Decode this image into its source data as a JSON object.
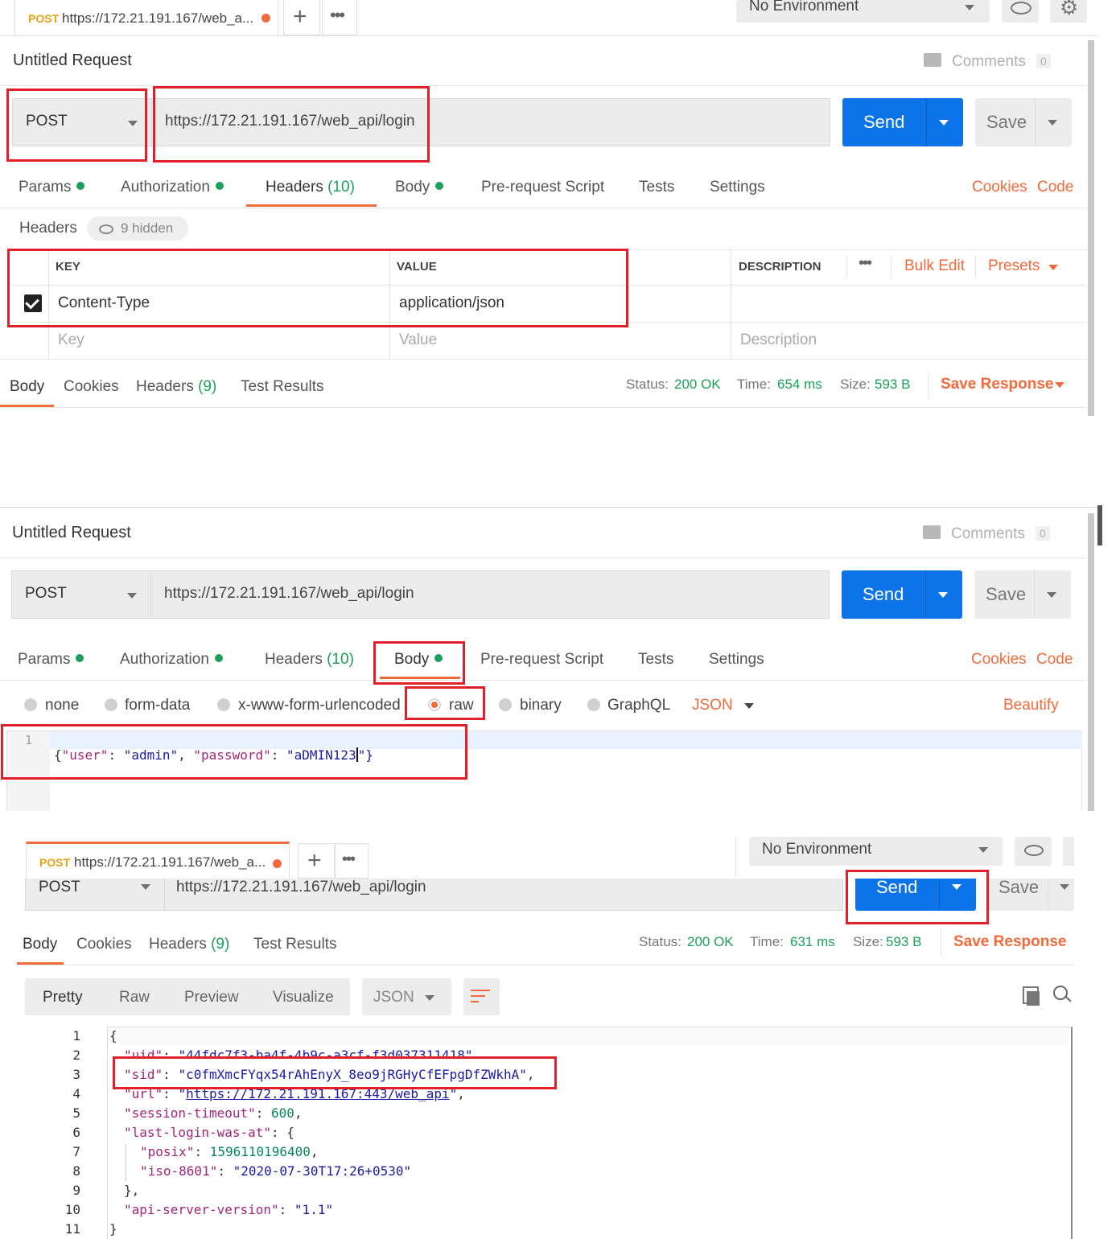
{
  "colors": {
    "accent": "#f26b3a",
    "send": "#0c74e8",
    "ok": "#1aa05a",
    "annotation": "#e2202a"
  },
  "panel1": {
    "tab": {
      "method": "POST",
      "title": "https://172.21.191.167/web_a..."
    },
    "environment": "No Environment",
    "request_name": "Untitled Request",
    "comments_label": "Comments",
    "comments_count": "0",
    "method": "POST",
    "url": "https://172.21.191.167/web_api/login",
    "send_label": "Send",
    "save_label": "Save",
    "tabs": {
      "params": "Params",
      "authorization": "Authorization",
      "headers": "Headers",
      "headers_count": "(10)",
      "body": "Body",
      "prerequest": "Pre-request Script",
      "tests": "Tests",
      "settings": "Settings",
      "cookies": "Cookies",
      "code": "Code"
    },
    "headers_title": "Headers",
    "hidden_label": "9 hidden",
    "columns": {
      "key": "KEY",
      "value": "VALUE",
      "description": "DESCRIPTION",
      "bulk_edit": "Bulk Edit",
      "presets": "Presets"
    },
    "row": {
      "key": "Content-Type",
      "value": "application/json"
    },
    "placeholders": {
      "key": "Key",
      "value": "Value",
      "description": "Description"
    },
    "response_tabs": {
      "body": "Body",
      "cookies": "Cookies",
      "headers": "Headers",
      "headers_count": "(9)",
      "test_results": "Test Results"
    },
    "status": {
      "status_label": "Status:",
      "status_value": "200 OK",
      "time_label": "Time:",
      "time_value": "654 ms",
      "size_label": "Size:",
      "size_value": "593 B",
      "save_response": "Save Response"
    }
  },
  "panel2": {
    "request_name": "Untitled Request",
    "comments_label": "Comments",
    "comments_count": "0",
    "method": "POST",
    "url": "https://172.21.191.167/web_api/login",
    "send_label": "Send",
    "save_label": "Save",
    "tabs": {
      "params": "Params",
      "authorization": "Authorization",
      "headers": "Headers",
      "headers_count": "(10)",
      "body": "Body",
      "prerequest": "Pre-request Script",
      "tests": "Tests",
      "settings": "Settings",
      "cookies": "Cookies",
      "code": "Code"
    },
    "body_types": {
      "none": "none",
      "form_data": "form-data",
      "urlencoded": "x-www-form-urlencoded",
      "raw": "raw",
      "binary": "binary",
      "graphql": "GraphQL",
      "format": "JSON",
      "beautify": "Beautify"
    },
    "editor": {
      "line_number": "1",
      "open": "{",
      "k1": "\"user\"",
      "colon1": ": ",
      "v1": "\"admin\"",
      "comma1": ", ",
      "k2": "\"password\"",
      "colon2": ": ",
      "v2": "\"aDMIN123",
      "close": "\"}"
    }
  },
  "panel3": {
    "tab": {
      "method": "POST",
      "title": "https://172.21.191.167/web_a..."
    },
    "environment": "No Environment",
    "method": "POST",
    "url": "https://172.21.191.167/web_api/login",
    "send_label": "Send",
    "save_label": "Save",
    "response_tabs": {
      "body": "Body",
      "cookies": "Cookies",
      "headers": "Headers",
      "headers_count": "(9)",
      "test_results": "Test Results"
    },
    "status": {
      "status_label": "Status:",
      "status_value": "200 OK",
      "time_label": "Time:",
      "time_value": "631 ms",
      "size_label": "Size:",
      "size_value": "593 B",
      "save_response": "Save Response"
    },
    "view_modes": {
      "pretty": "Pretty",
      "raw": "Raw",
      "preview": "Preview",
      "visualize": "Visualize",
      "format": "JSON"
    },
    "line_numbers": [
      "1",
      "2",
      "3",
      "4",
      "5",
      "6",
      "7",
      "8",
      "9",
      "10",
      "11"
    ],
    "json": {
      "open": "{",
      "uid_key": "\"uid\"",
      "uid_val": "\"44fdc7f3-ba4f-4b9c-a3cf-f3d037311418\"",
      "sid_key": "\"sid\"",
      "sid_val": "\"c0fmXmcFYqx54rAhEnyX_8eo9jRGHyCfEFpgDfZWkhA\"",
      "url_key": "\"url\"",
      "url_val": "https://172.21.191.167:443/web_api",
      "timeout_key": "\"session-timeout\"",
      "timeout_val": "600",
      "last_login_key": "\"last-login-was-at\"",
      "posix_key": "\"posix\"",
      "posix_val": "1596110196400",
      "iso_key": "\"iso-8601\"",
      "iso_val": "\"2020-07-30T17:26+0530\"",
      "inner_close": "},",
      "version_key": "\"api-server-version\"",
      "version_val": "\"1.1\"",
      "close": "}"
    }
  },
  "icons": [
    "plus-icon",
    "more-icon",
    "eye-icon",
    "gear-icon",
    "comment-icon",
    "checkbox-icon",
    "wrap-icon",
    "copy-icon",
    "search-icon"
  ]
}
